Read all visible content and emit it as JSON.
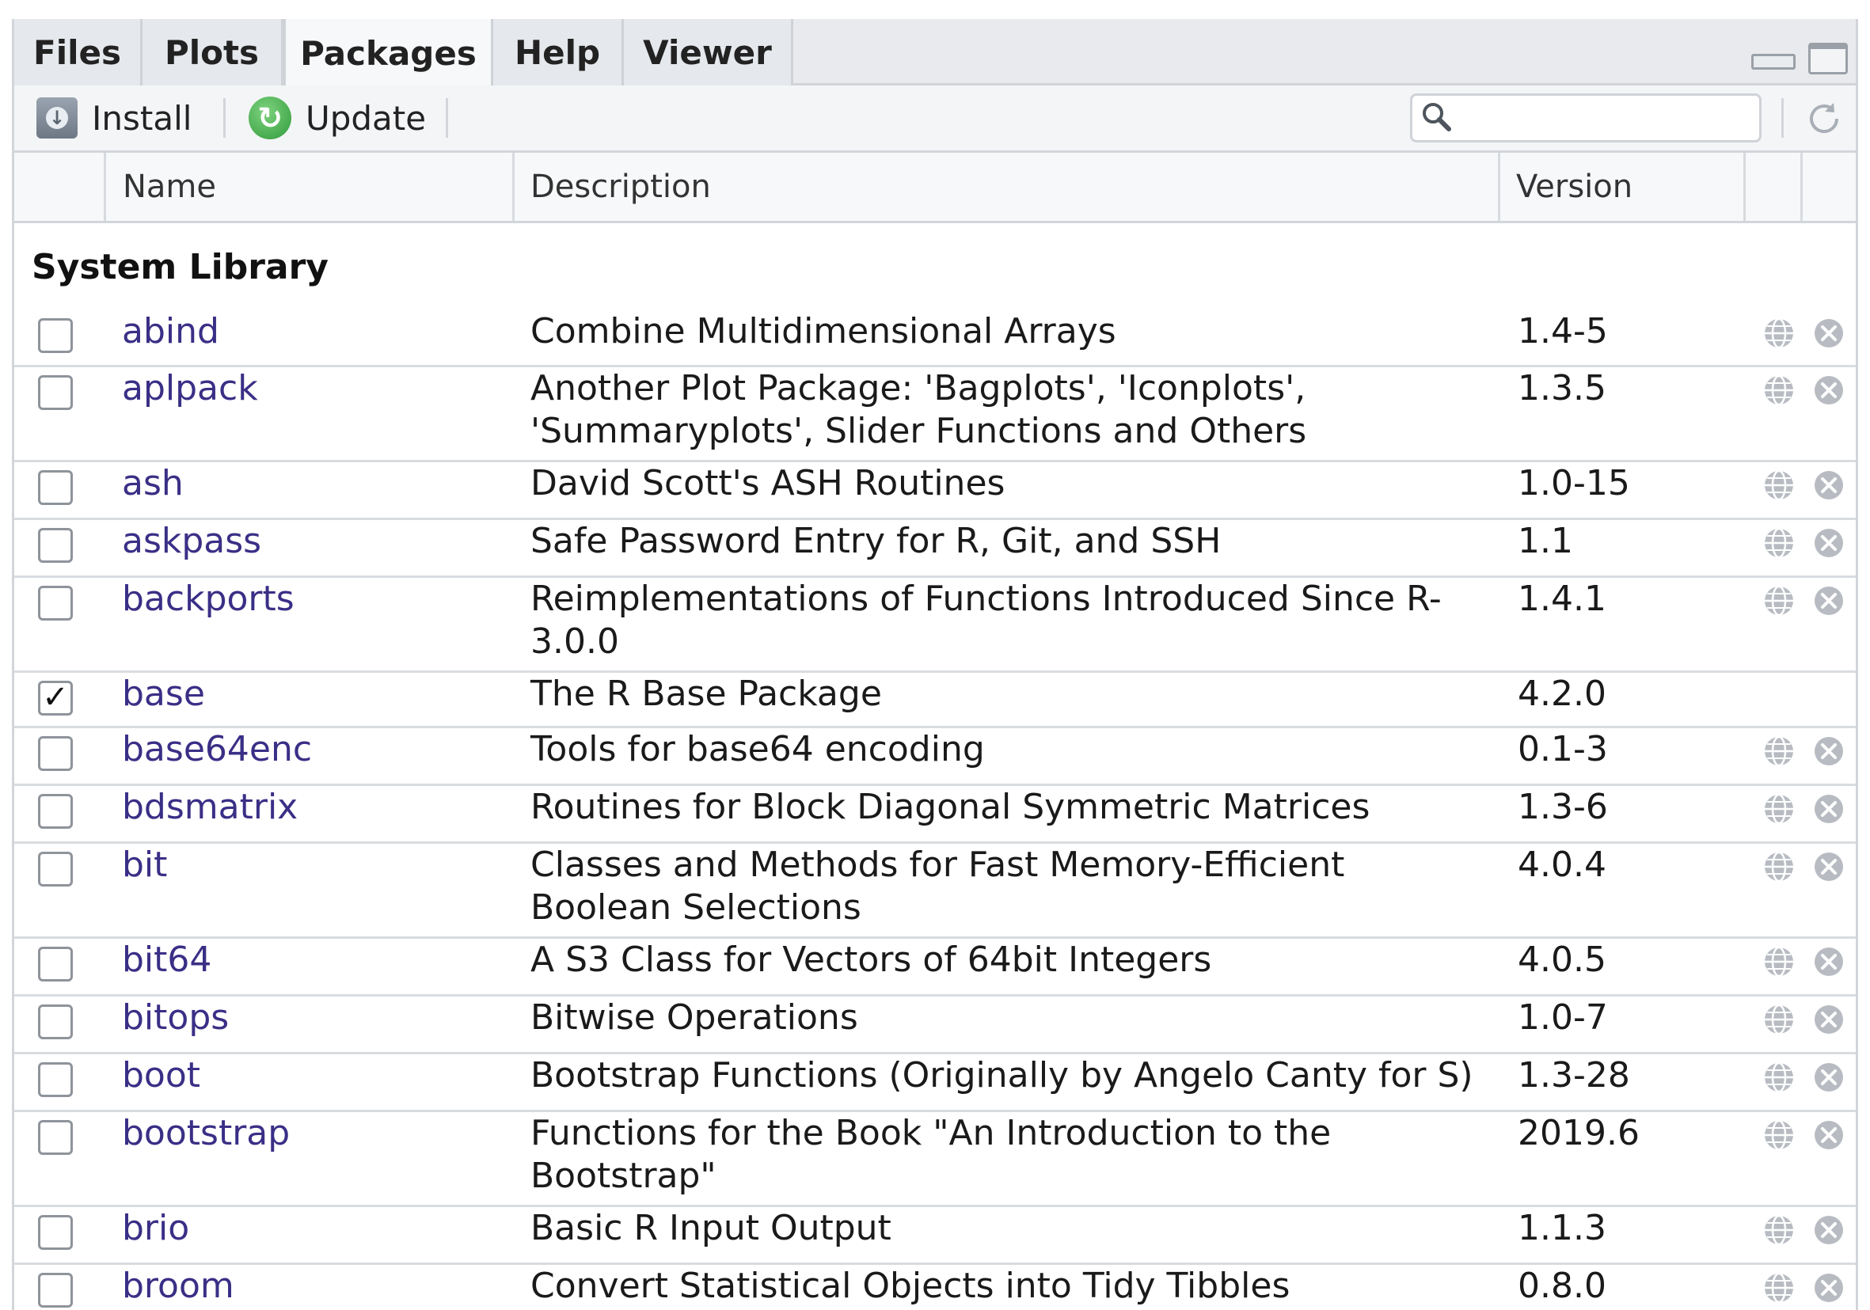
{
  "tabs": [
    {
      "id": "files",
      "label": "Files"
    },
    {
      "id": "plots",
      "label": "Plots"
    },
    {
      "id": "packages",
      "label": "Packages"
    },
    {
      "id": "help",
      "label": "Help"
    },
    {
      "id": "viewer",
      "label": "Viewer"
    }
  ],
  "active_tab": "Packages",
  "toolbar": {
    "install_label": "Install",
    "update_label": "Update",
    "search_value": "",
    "icons": [
      "install-icon",
      "update-icon",
      "search-icon",
      "refresh-icon",
      "minimize-icon",
      "maximize-icon"
    ]
  },
  "columns": {
    "name": "Name",
    "description": "Description",
    "version": "Version"
  },
  "section_title": "System Library",
  "colors": {
    "link": "#3a2f86",
    "update_green": "#2f9a3a"
  },
  "packages": [
    {
      "name": "abind",
      "description": "Combine Multidimensional Arrays",
      "version": "1.4-5",
      "checked": false
    },
    {
      "name": "aplpack",
      "description": "Another Plot Package: 'Bagplots', 'Iconplots', 'Summaryplots', Slider Functions and Others",
      "version": "1.3.5",
      "checked": false
    },
    {
      "name": "ash",
      "description": "David Scott's ASH Routines",
      "version": "1.0-15",
      "checked": false
    },
    {
      "name": "askpass",
      "description": "Safe Password Entry for R, Git, and SSH",
      "version": "1.1",
      "checked": false
    },
    {
      "name": "backports",
      "description": "Reimplementations of Functions Introduced Since R-3.0.0",
      "version": "1.4.1",
      "checked": false
    },
    {
      "name": "base",
      "description": "The R Base Package",
      "version": "4.2.0",
      "checked": true
    },
    {
      "name": "base64enc",
      "description": "Tools for base64 encoding",
      "version": "0.1-3",
      "checked": false
    },
    {
      "name": "bdsmatrix",
      "description": "Routines for Block Diagonal Symmetric Matrices",
      "version": "1.3-6",
      "checked": false
    },
    {
      "name": "bit",
      "description": "Classes and Methods for Fast Memory-Efficient Boolean Selections",
      "version": "4.0.4",
      "checked": false
    },
    {
      "name": "bit64",
      "description": "A S3 Class for Vectors of 64bit Integers",
      "version": "4.0.5",
      "checked": false
    },
    {
      "name": "bitops",
      "description": "Bitwise Operations",
      "version": "1.0-7",
      "checked": false
    },
    {
      "name": "boot",
      "description": "Bootstrap Functions (Originally by Angelo Canty for S)",
      "version": "1.3-28",
      "checked": false
    },
    {
      "name": "bootstrap",
      "description": "Functions for the Book \"An Introduction to the Bootstrap\"",
      "version": "2019.6",
      "checked": false
    },
    {
      "name": "brio",
      "description": "Basic R Input Output",
      "version": "1.1.3",
      "checked": false
    },
    {
      "name": "broom",
      "description": "Convert Statistical Objects into Tidy Tibbles",
      "version": "0.8.0",
      "checked": false
    }
  ]
}
